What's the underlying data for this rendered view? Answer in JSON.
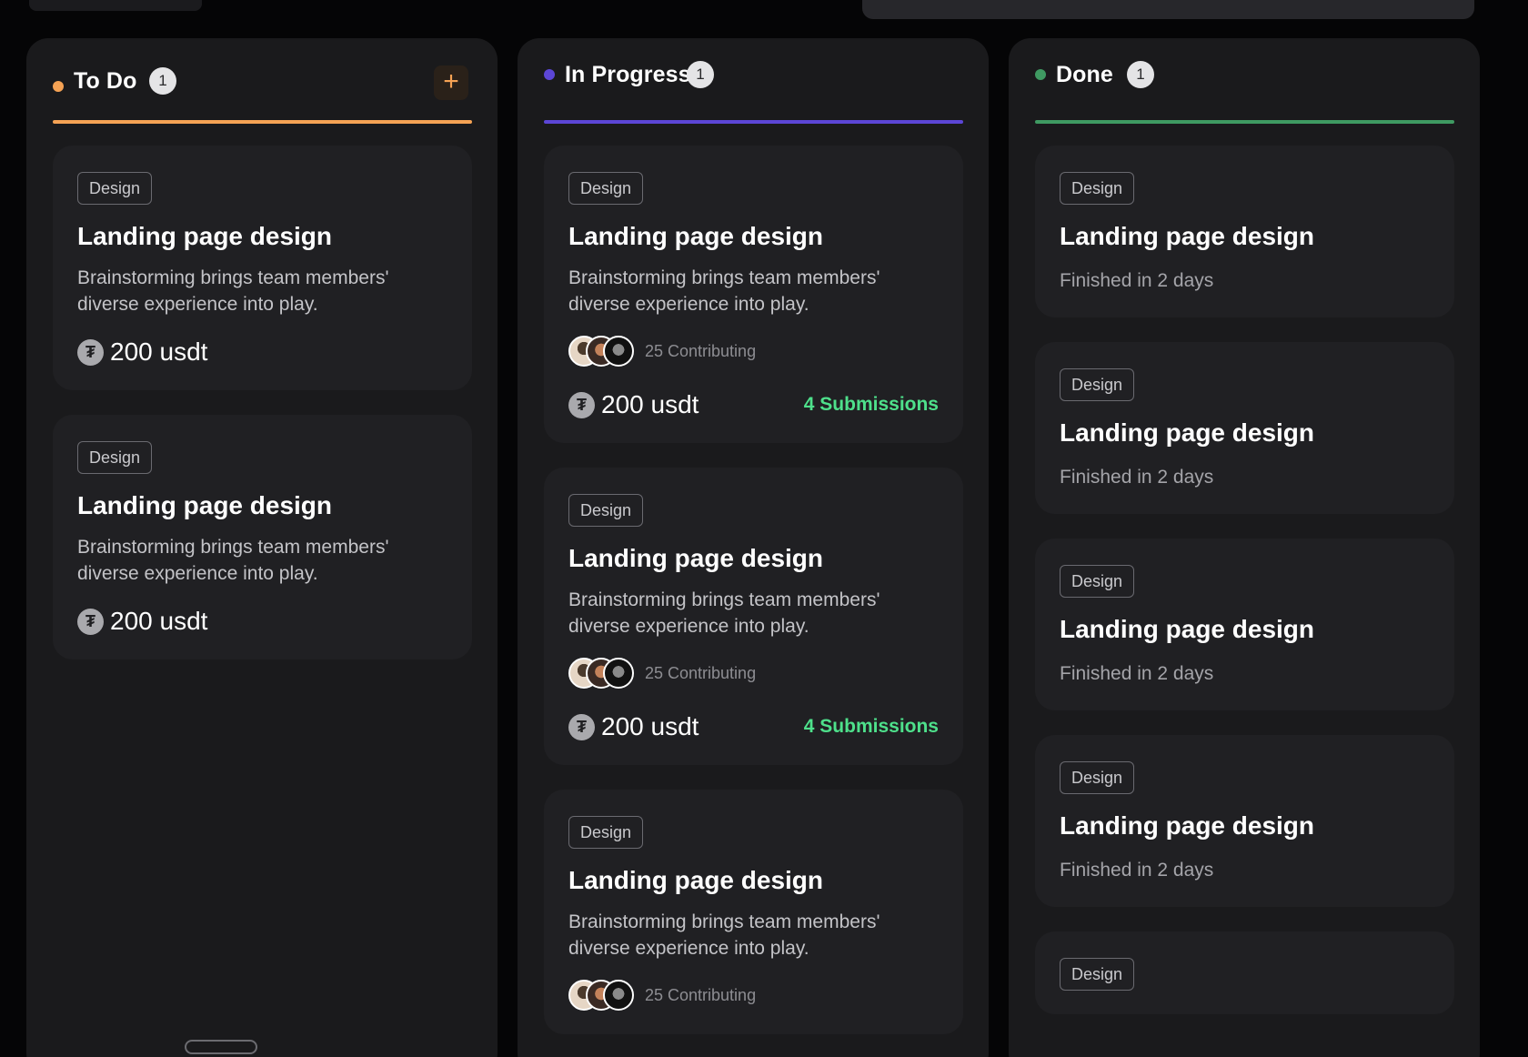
{
  "colors": {
    "todo": "#f5a254",
    "progress": "#5c46d6",
    "done": "#3f9a62",
    "submissions": "#4ee08b"
  },
  "columns": {
    "todo": {
      "title": "To Do",
      "count": "1",
      "add_icon": "+"
    },
    "progress": {
      "title": "In Progress",
      "count": "1"
    },
    "done": {
      "title": "Done",
      "count": "1"
    }
  },
  "card": {
    "tag": "Design",
    "title": "Landing page design",
    "desc": "Brainstorming brings team members' diverse experience into play.",
    "reward": "200 usdt",
    "coin_icon": "₮",
    "submissions": "4 Submissions",
    "contributing": "25 Contributing",
    "finished": "Finished in 2 days"
  }
}
